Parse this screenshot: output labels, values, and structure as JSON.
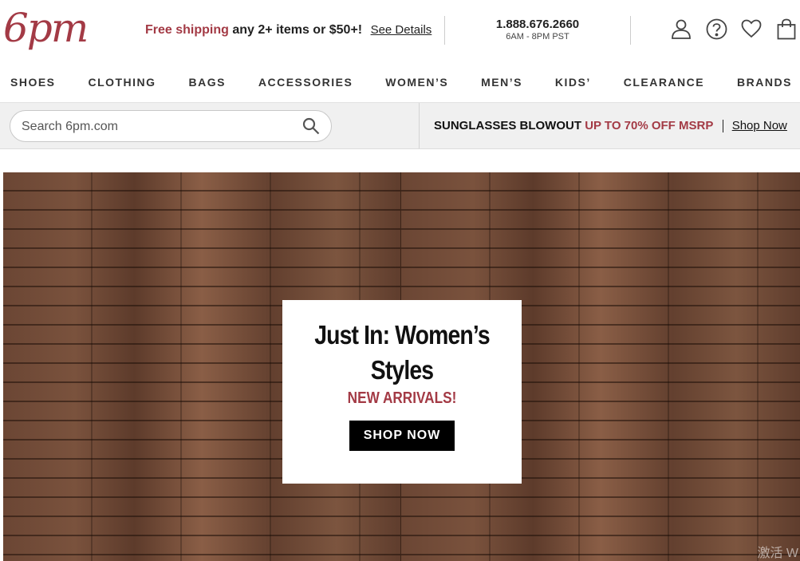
{
  "header": {
    "logo": "6pm",
    "promo": {
      "accent": "Free shipping",
      "text": "any 2+ items or $50+!",
      "link": "See Details"
    },
    "phone": {
      "number": "1.888.676.2660",
      "hours": "6AM - 8PM PST"
    },
    "icons": [
      "account-icon",
      "help-icon",
      "favorites-icon",
      "shopping-bag-icon"
    ]
  },
  "nav": {
    "items": [
      "SHOES",
      "CLOTHING",
      "BAGS",
      "ACCESSORIES",
      "WOMEN’S",
      "MEN’S",
      "KIDS’",
      "CLEARANCE",
      "BRANDS"
    ]
  },
  "search": {
    "placeholder": "Search 6pm.com"
  },
  "sale_banner": {
    "title": "SUNGLASSES BLOWOUT",
    "accent": "UP TO 70% OFF MSRP",
    "link": "Shop Now"
  },
  "hero": {
    "headline": "Just In: Women’s Styles",
    "subheadline": "NEW ARRIVALS!",
    "button": "SHOP NOW",
    "watermark": "激活 W"
  },
  "colors": {
    "brand": "#a33a45",
    "text": "#222222",
    "button_bg": "#000000"
  }
}
